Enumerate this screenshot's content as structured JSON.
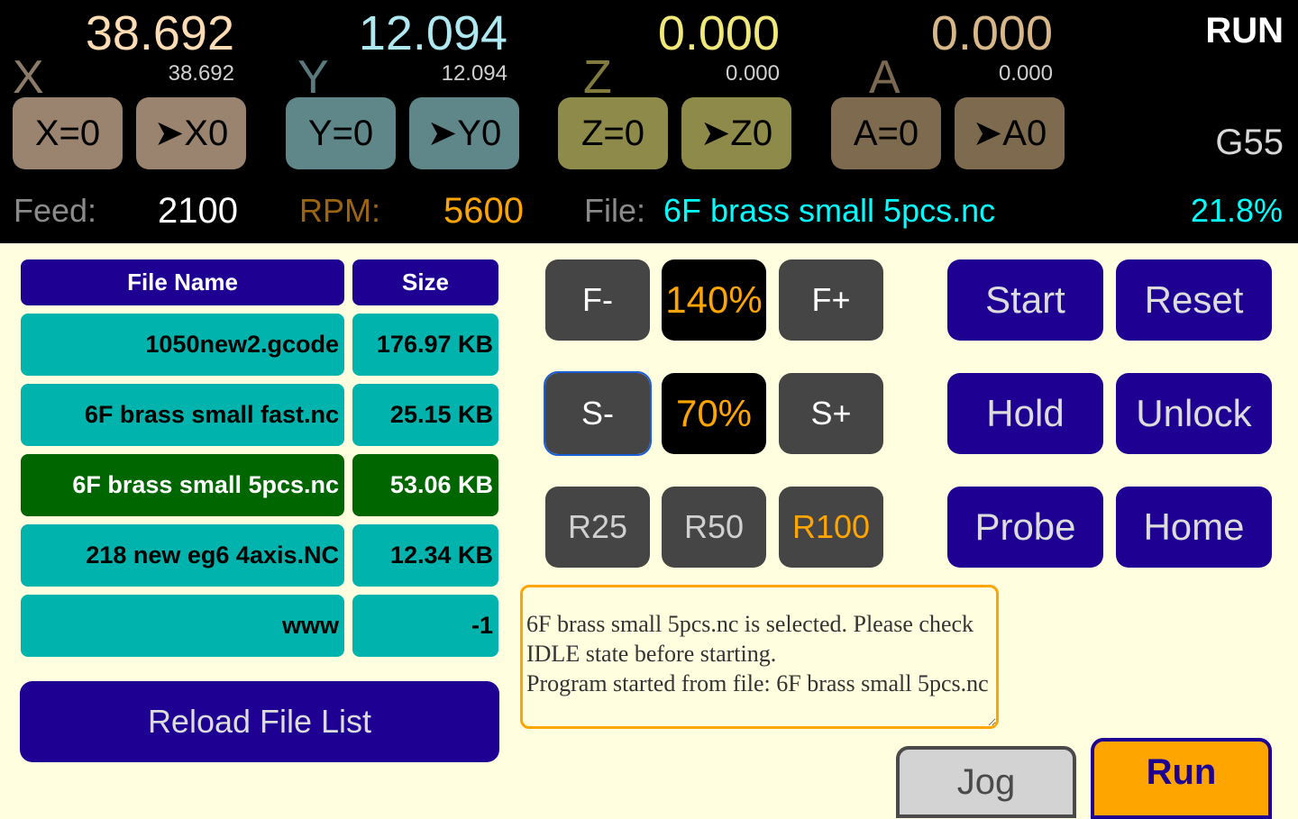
{
  "axes": [
    {
      "name": "X",
      "work": "38.692",
      "machine": "38.692",
      "zero_label": "X=0",
      "goto_label": "➤X0",
      "value_color": "#ffdcb4",
      "letter_color": "#8c7b69",
      "button_color": "#9a8470"
    },
    {
      "name": "Y",
      "work": "12.094",
      "machine": "12.094",
      "zero_label": "Y=0",
      "goto_label": "➤Y0",
      "value_color": "#aee8f0",
      "letter_color": "#5a7a7e",
      "button_color": "#5f8689"
    },
    {
      "name": "Z",
      "work": "0.000",
      "machine": "0.000",
      "zero_label": "Z=0",
      "goto_label": "➤Z0",
      "value_color": "#f0e878",
      "letter_color": "#807a3e",
      "button_color": "#8e8a4a"
    },
    {
      "name": "A",
      "work": "0.000",
      "machine": "0.000",
      "zero_label": "A=0",
      "goto_label": "➤A0",
      "value_color": "#d8b888",
      "letter_color": "#7a6850",
      "button_color": "#7d6a4f"
    }
  ],
  "status": {
    "state": "RUN",
    "wcs": "G55"
  },
  "info": {
    "feed_label": "Feed:",
    "feed_value": "2100",
    "rpm_label": "RPM:",
    "rpm_value": "5600",
    "file_label": "File:",
    "file_value": "6F brass small 5pcs.nc",
    "progress": "21.8%"
  },
  "files": {
    "headers": {
      "name": "File Name",
      "size": "Size"
    },
    "rows": [
      {
        "name": "1050new2.gcode",
        "size": "176.97 KB",
        "selected": false
      },
      {
        "name": "6F brass small fast.nc",
        "size": "25.15 KB",
        "selected": false
      },
      {
        "name": "6F brass small 5pcs.nc",
        "size": "53.06 KB",
        "selected": true
      },
      {
        "name": "218 new eg6 4axis.NC",
        "size": "12.34 KB",
        "selected": false
      },
      {
        "name": "www",
        "size": "-1",
        "selected": false
      }
    ],
    "reload_label": "Reload File List"
  },
  "overrides": {
    "feed_minus": "F-",
    "feed_value": "140%",
    "feed_plus": "F+",
    "spindle_minus": "S-",
    "spindle_value": "70%",
    "spindle_plus": "S+",
    "rapid_25": "R25",
    "rapid_50": "R50",
    "rapid_100": "R100",
    "rapid_active": "R100"
  },
  "controls": {
    "start": "Start",
    "reset": "Reset",
    "hold": "Hold",
    "unlock": "Unlock",
    "probe": "Probe",
    "home": "Home"
  },
  "log": {
    "text": "6F brass small 5pcs.nc is selected. Please check IDLE state before starting.\nProgram started from file: 6F brass small 5pcs.nc"
  },
  "tabs": {
    "jog": "Jog",
    "run": "Run",
    "active": "Run"
  }
}
